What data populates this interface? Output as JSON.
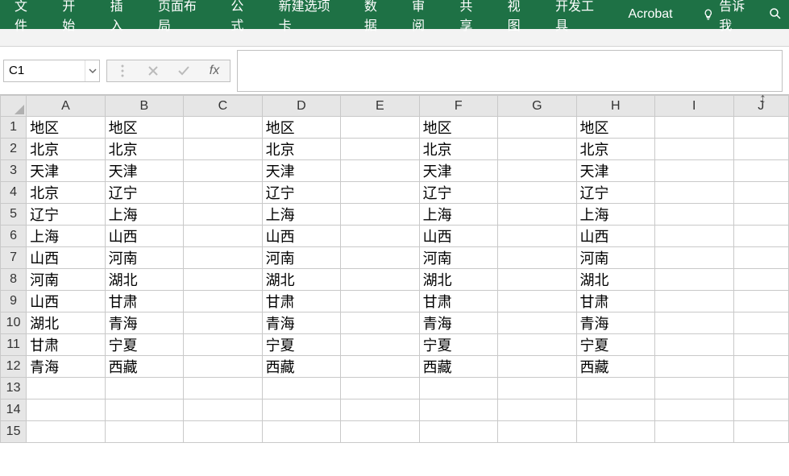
{
  "ribbon": {
    "tabs": [
      "文件",
      "开始",
      "插入",
      "页面布局",
      "公式",
      "新建选项卡",
      "数据",
      "审阅",
      "共享",
      "视图",
      "开发工具",
      "Acrobat"
    ],
    "tell_me": "告诉我"
  },
  "formula_bar": {
    "name_box": "C1",
    "fx_label": "fx",
    "formula": ""
  },
  "sheet": {
    "columns": [
      "A",
      "B",
      "C",
      "D",
      "E",
      "F",
      "G",
      "H",
      "I",
      "J"
    ],
    "row_count": 15,
    "cells": {
      "r1": {
        "A": "地区",
        "B": "地区",
        "D": "地区",
        "F": "地区",
        "H": "地区"
      },
      "r2": {
        "A": "北京",
        "B": "北京",
        "D": "北京",
        "F": "北京",
        "H": "北京"
      },
      "r3": {
        "A": "天津",
        "B": "天津",
        "D": "天津",
        "F": "天津",
        "H": "天津"
      },
      "r4": {
        "A": "北京",
        "B": "辽宁",
        "D": "辽宁",
        "F": "辽宁",
        "H": "辽宁"
      },
      "r5": {
        "A": "辽宁",
        "B": "上海",
        "D": "上海",
        "F": "上海",
        "H": "上海"
      },
      "r6": {
        "A": "上海",
        "B": "山西",
        "D": "山西",
        "F": "山西",
        "H": "山西"
      },
      "r7": {
        "A": "山西",
        "B": "河南",
        "D": "河南",
        "F": "河南",
        "H": "河南"
      },
      "r8": {
        "A": "河南",
        "B": "湖北",
        "D": "湖北",
        "F": "湖北",
        "H": "湖北"
      },
      "r9": {
        "A": "山西",
        "B": "甘肃",
        "D": "甘肃",
        "F": "甘肃",
        "H": "甘肃"
      },
      "r10": {
        "A": "湖北",
        "B": "青海",
        "D": "青海",
        "F": "青海",
        "H": "青海"
      },
      "r11": {
        "A": "甘肃",
        "B": "宁夏",
        "D": "宁夏",
        "F": "宁夏",
        "H": "宁夏"
      },
      "r12": {
        "A": "青海",
        "B": "西藏",
        "D": "西藏",
        "F": "西藏",
        "H": "西藏"
      }
    }
  }
}
